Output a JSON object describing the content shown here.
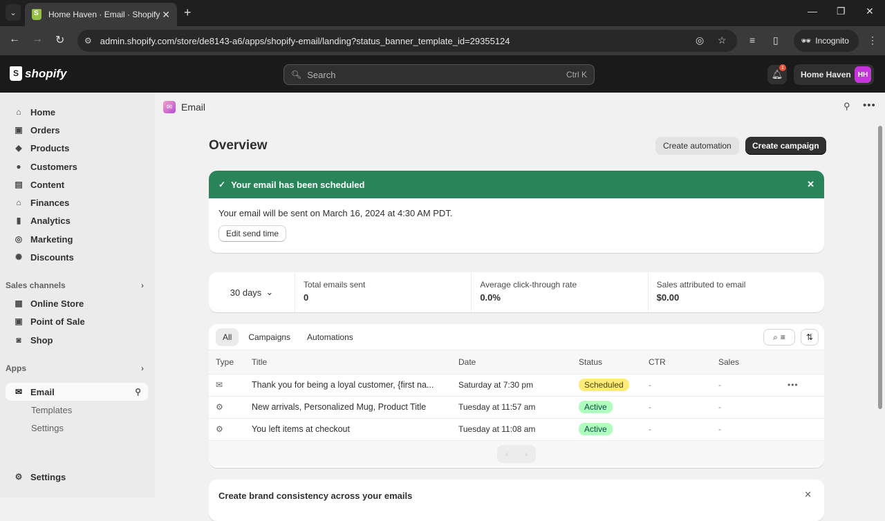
{
  "browser": {
    "tab_title": "Home Haven · Email · Shopify",
    "url": "admin.shopify.com/store/de8143-a6/apps/shopify-email/landing?status_banner_template_id=29355124",
    "incognito_label": "Incognito"
  },
  "topbar": {
    "logo_text": "shopify",
    "search_placeholder": "Search",
    "search_shortcut": "Ctrl K",
    "notification_count": "1",
    "store_name": "Home Haven",
    "store_initials": "HH"
  },
  "sidebar": {
    "items": [
      {
        "label": "Home",
        "icon": "home-icon"
      },
      {
        "label": "Orders",
        "icon": "inbox-icon"
      },
      {
        "label": "Products",
        "icon": "tag-icon"
      },
      {
        "label": "Customers",
        "icon": "person-icon"
      },
      {
        "label": "Content",
        "icon": "image-icon"
      },
      {
        "label": "Finances",
        "icon": "bank-icon"
      },
      {
        "label": "Analytics",
        "icon": "bar-chart-icon"
      },
      {
        "label": "Marketing",
        "icon": "target-icon"
      },
      {
        "label": "Discounts",
        "icon": "discount-icon"
      }
    ],
    "sales_channels_heading": "Sales channels",
    "sales_channels": [
      {
        "label": "Online Store",
        "icon": "store-icon"
      },
      {
        "label": "Point of Sale",
        "icon": "pos-icon"
      },
      {
        "label": "Shop",
        "icon": "shop-icon"
      }
    ],
    "apps_heading": "Apps",
    "apps": [
      {
        "label": "Email",
        "icon": "email-icon",
        "active": true,
        "subitems": [
          "Templates",
          "Settings"
        ]
      }
    ],
    "settings_label": "Settings"
  },
  "page": {
    "app_name": "Email",
    "title": "Overview",
    "create_automation_label": "Create automation",
    "create_campaign_label": "Create campaign"
  },
  "banner": {
    "title": "Your email has been scheduled",
    "message": "Your email will be sent on March 16, 2024 at 4:30 AM PDT.",
    "button_label": "Edit send time",
    "color": "#29845a"
  },
  "metrics": {
    "range": "30 days",
    "items": [
      {
        "label": "Total emails sent",
        "value": "0"
      },
      {
        "label": "Average click-through rate",
        "value": "0.0%"
      },
      {
        "label": "Sales attributed to email",
        "value": "$0.00"
      }
    ]
  },
  "table": {
    "tabs": [
      "All",
      "Campaigns",
      "Automations"
    ],
    "selected_tab": "All",
    "columns": [
      "Type",
      "Title",
      "Date",
      "Status",
      "CTR",
      "Sales"
    ],
    "rows": [
      {
        "type_icon": "email-icon",
        "title": "Thank you for being a loyal customer, {first na...",
        "date": "Saturday at 7:30 pm",
        "status": "Scheduled",
        "ctr": "-",
        "sales": "-"
      },
      {
        "type_icon": "automation-gear-icon",
        "title": "New arrivals, Personalized Mug, Product Title",
        "date": "Tuesday at 11:57 am",
        "status": "Active",
        "ctr": "-",
        "sales": "-"
      },
      {
        "type_icon": "automation-gear-icon",
        "title": "You left items at checkout",
        "date": "Tuesday at 11:08 am",
        "status": "Active",
        "ctr": "-",
        "sales": "-"
      }
    ]
  },
  "brand_card": {
    "title": "Create brand consistency across your emails"
  }
}
